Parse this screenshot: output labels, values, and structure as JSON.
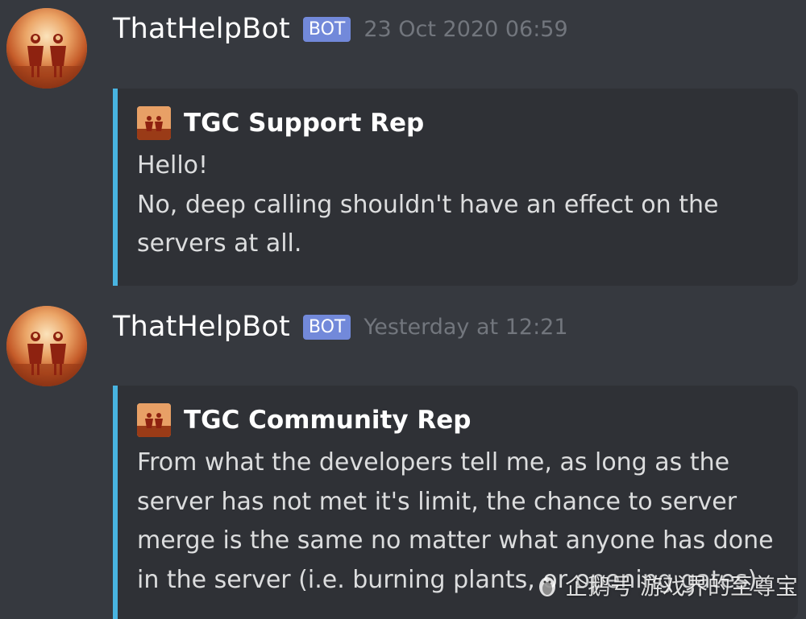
{
  "messages": [
    {
      "username": "ThatHelpBot",
      "bot_tag": "BOT",
      "timestamp": "23 Oct 2020 06:59",
      "avatar_icon": "sky-children-avatar-icon",
      "embed": {
        "accent_color": "#48b4e0",
        "author_icon": "sky-children-icon",
        "author": "TGC Support Rep",
        "lines": [
          "Hello!",
          "No, deep calling shouldn't have an effect on the",
          "servers at all."
        ]
      }
    },
    {
      "username": "ThatHelpBot",
      "bot_tag": "BOT",
      "timestamp": "Yesterday at 12:21",
      "avatar_icon": "sky-children-avatar-icon",
      "embed": {
        "accent_color": "#48b4e0",
        "author_icon": "sky-children-icon",
        "author": "TGC Community Rep",
        "lines": [
          "From what the developers tell me, as long as the",
          "server has not met it's limit, the chance to server",
          "merge is the same no matter what anyone has done",
          "in the server (i.e. burning plants, or opening gates)."
        ]
      }
    }
  ],
  "watermark": {
    "icon": "penguin-icon",
    "text": "企鹅号 游戏界的至尊宝"
  },
  "colors": {
    "background": "#36393f",
    "embed_background": "#2f3136",
    "bot_tag": "#7289da",
    "timestamp": "#72767d"
  }
}
